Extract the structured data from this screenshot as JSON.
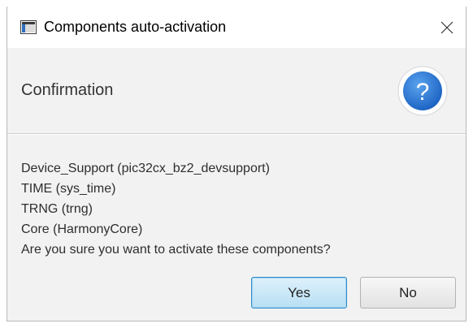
{
  "window": {
    "title": "Components auto-activation"
  },
  "header": {
    "title": "Confirmation",
    "icon": "question-icon"
  },
  "message": {
    "lines": [
      "Device_Support (pic32cx_bz2_devsupport)",
      "TIME (sys_time)",
      "TRNG (trng)",
      "Core (HarmonyCore)",
      "Are you sure you want to activate these components?"
    ]
  },
  "buttons": {
    "yes_label": "Yes",
    "no_label": "No"
  },
  "colors": {
    "accent": "#2a7ad6",
    "default_button_border": "#2f8ccd",
    "dialog_background": "#f2f2f2"
  }
}
